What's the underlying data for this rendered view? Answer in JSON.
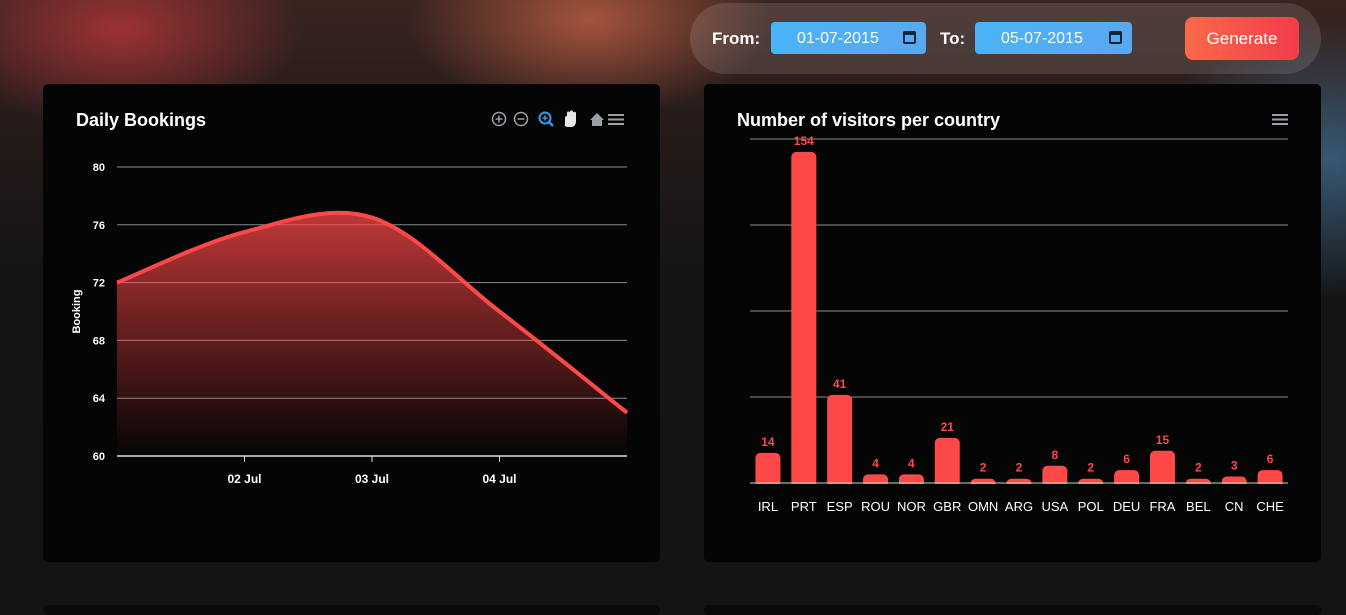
{
  "filter": {
    "from_label": "From:",
    "from_value": "01-07-2015",
    "to_label": "To:",
    "to_value": "05-07-2015",
    "generate_label": "Generate"
  },
  "colors": {
    "accent": "#ff4848",
    "generate": "#f4524a",
    "date_field": "#4ab3f7"
  },
  "bookings_panel": {
    "title": "Daily Bookings",
    "toolbar_icons": [
      "zoom-in-icon",
      "zoom-out-icon",
      "selection-zoom-icon",
      "pan-hand-icon",
      "home-icon",
      "menu-icon"
    ]
  },
  "visitors_panel": {
    "title": "Number of visitors per country",
    "toolbar_icons": [
      "menu-icon"
    ]
  },
  "chart_data": [
    {
      "type": "area",
      "title": "Daily Bookings",
      "ylabel": "Booking",
      "xlabel": "",
      "ylim": [
        60,
        80
      ],
      "yticks": [
        60,
        64,
        68,
        72,
        76,
        80
      ],
      "x_ticks": [
        "02 Jul",
        "03 Jul",
        "04 Jul"
      ],
      "x": [
        "2015-07-01",
        "2015-07-02",
        "2015-07-03",
        "2015-07-04",
        "2015-07-05"
      ],
      "values": [
        72,
        75.5,
        76.5,
        70,
        63
      ],
      "grid": true
    },
    {
      "type": "bar",
      "title": "Number of visitors per country",
      "categories": [
        "IRL",
        "PRT",
        "ESP",
        "ROU",
        "NOR",
        "GBR",
        "OMN",
        "ARG",
        "USA",
        "POL",
        "DEU",
        "FRA",
        "BEL",
        "CN",
        "CHE"
      ],
      "values": [
        14,
        154,
        41,
        4,
        4,
        21,
        2,
        2,
        8,
        2,
        6,
        15,
        2,
        3,
        6
      ],
      "ylim": [
        0,
        160
      ],
      "grid": true,
      "data_labels": true
    }
  ]
}
